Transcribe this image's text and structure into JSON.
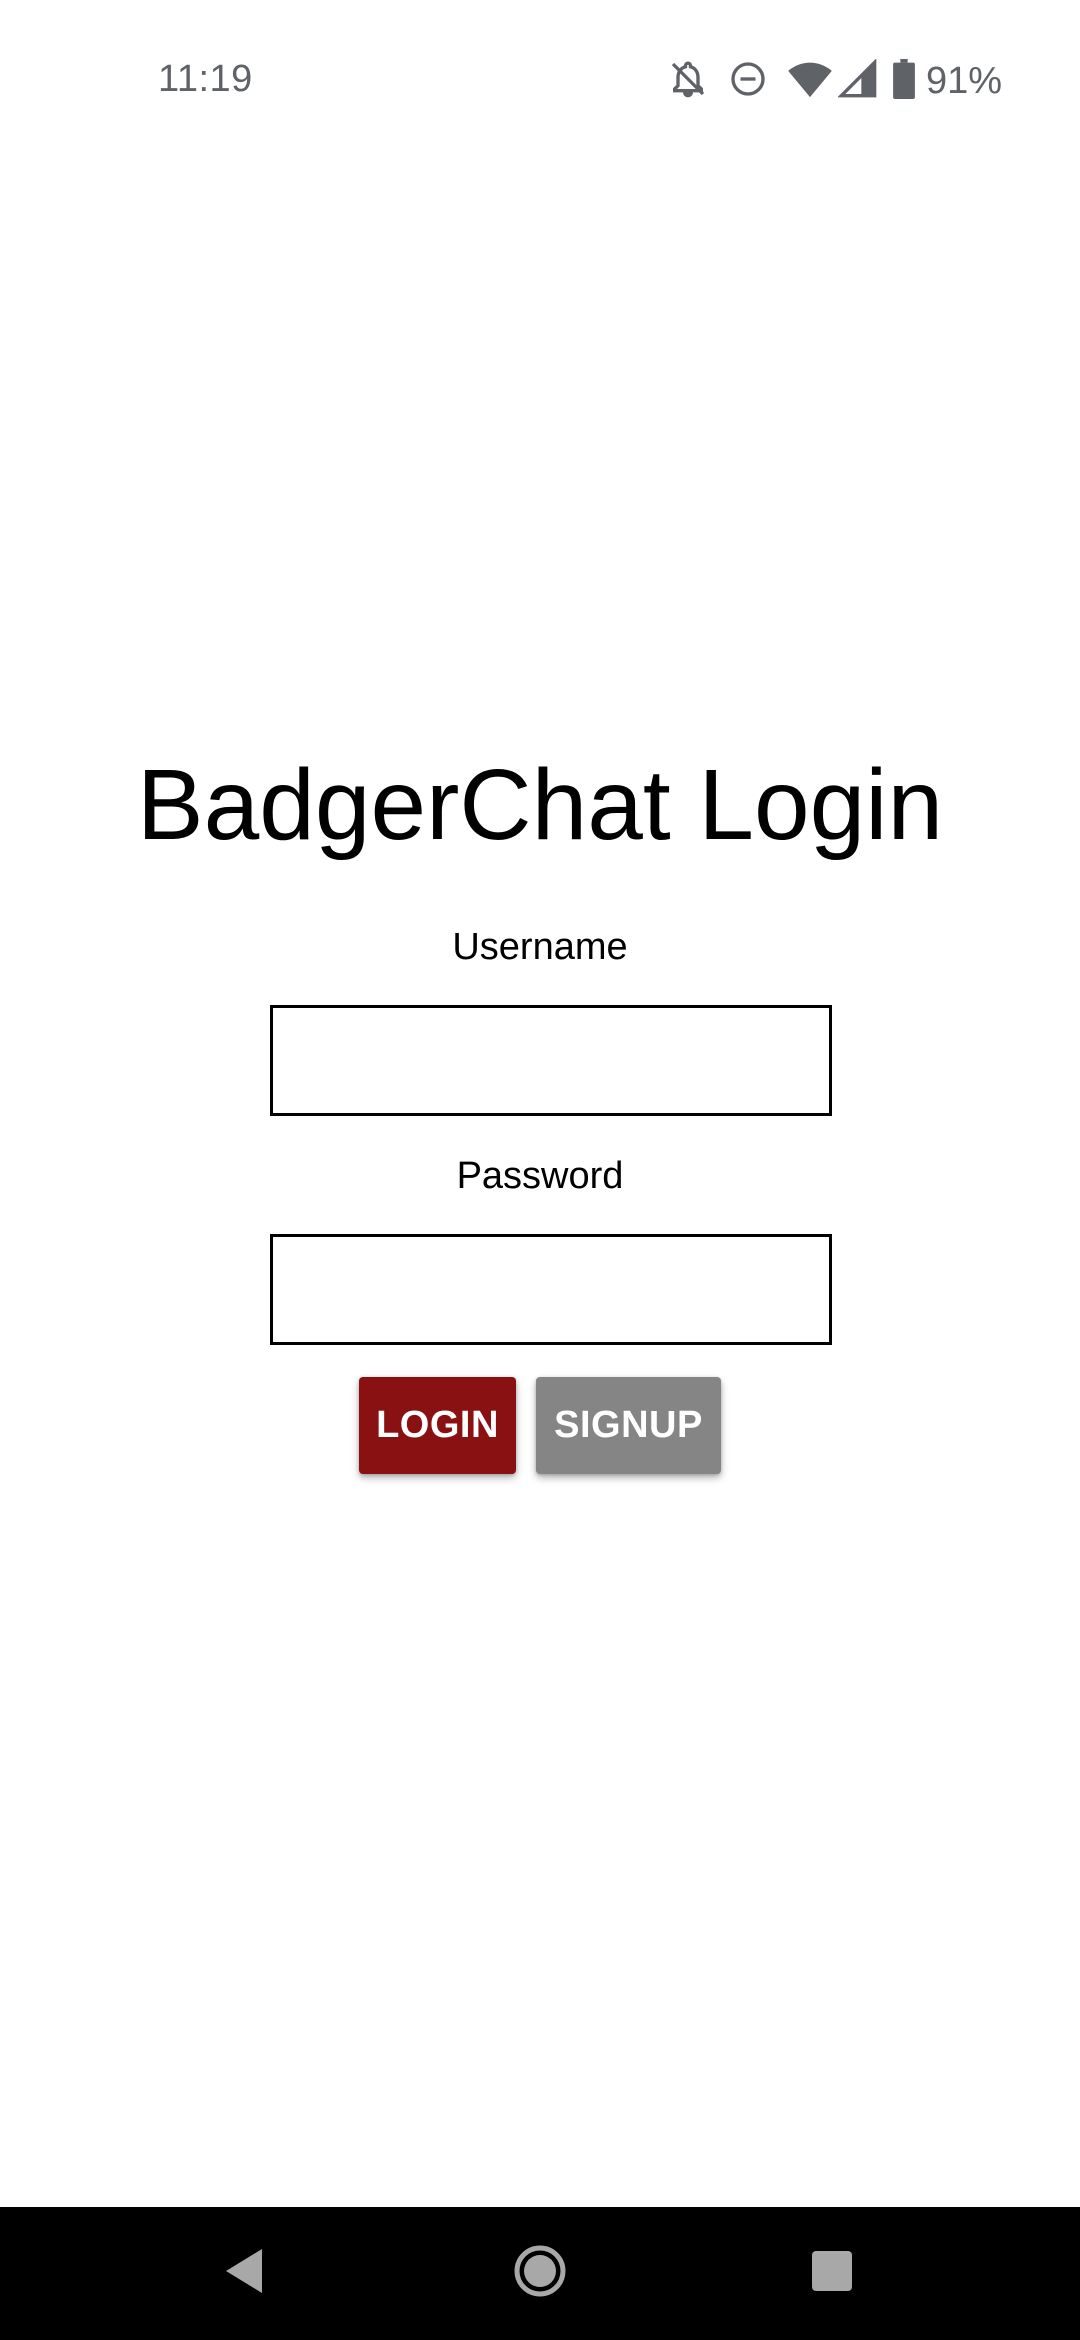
{
  "status_bar": {
    "time": "11:19",
    "battery_percent": "91%",
    "icons": [
      "notifications-off-icon",
      "do-not-disturb-icon",
      "wifi-icon",
      "cell-signal-icon",
      "battery-icon"
    ]
  },
  "login": {
    "title": "BadgerChat Login",
    "username_label": "Username",
    "username_value": "",
    "password_label": "Password",
    "password_value": "",
    "login_button": "LOGIN",
    "signup_button": "SIGNUP"
  },
  "colors": {
    "login_button": "#8a1111",
    "signup_button": "#858585",
    "nav_bar": "#000000"
  },
  "nav_bar": {
    "buttons": [
      "back-icon",
      "home-icon",
      "recents-icon"
    ]
  }
}
